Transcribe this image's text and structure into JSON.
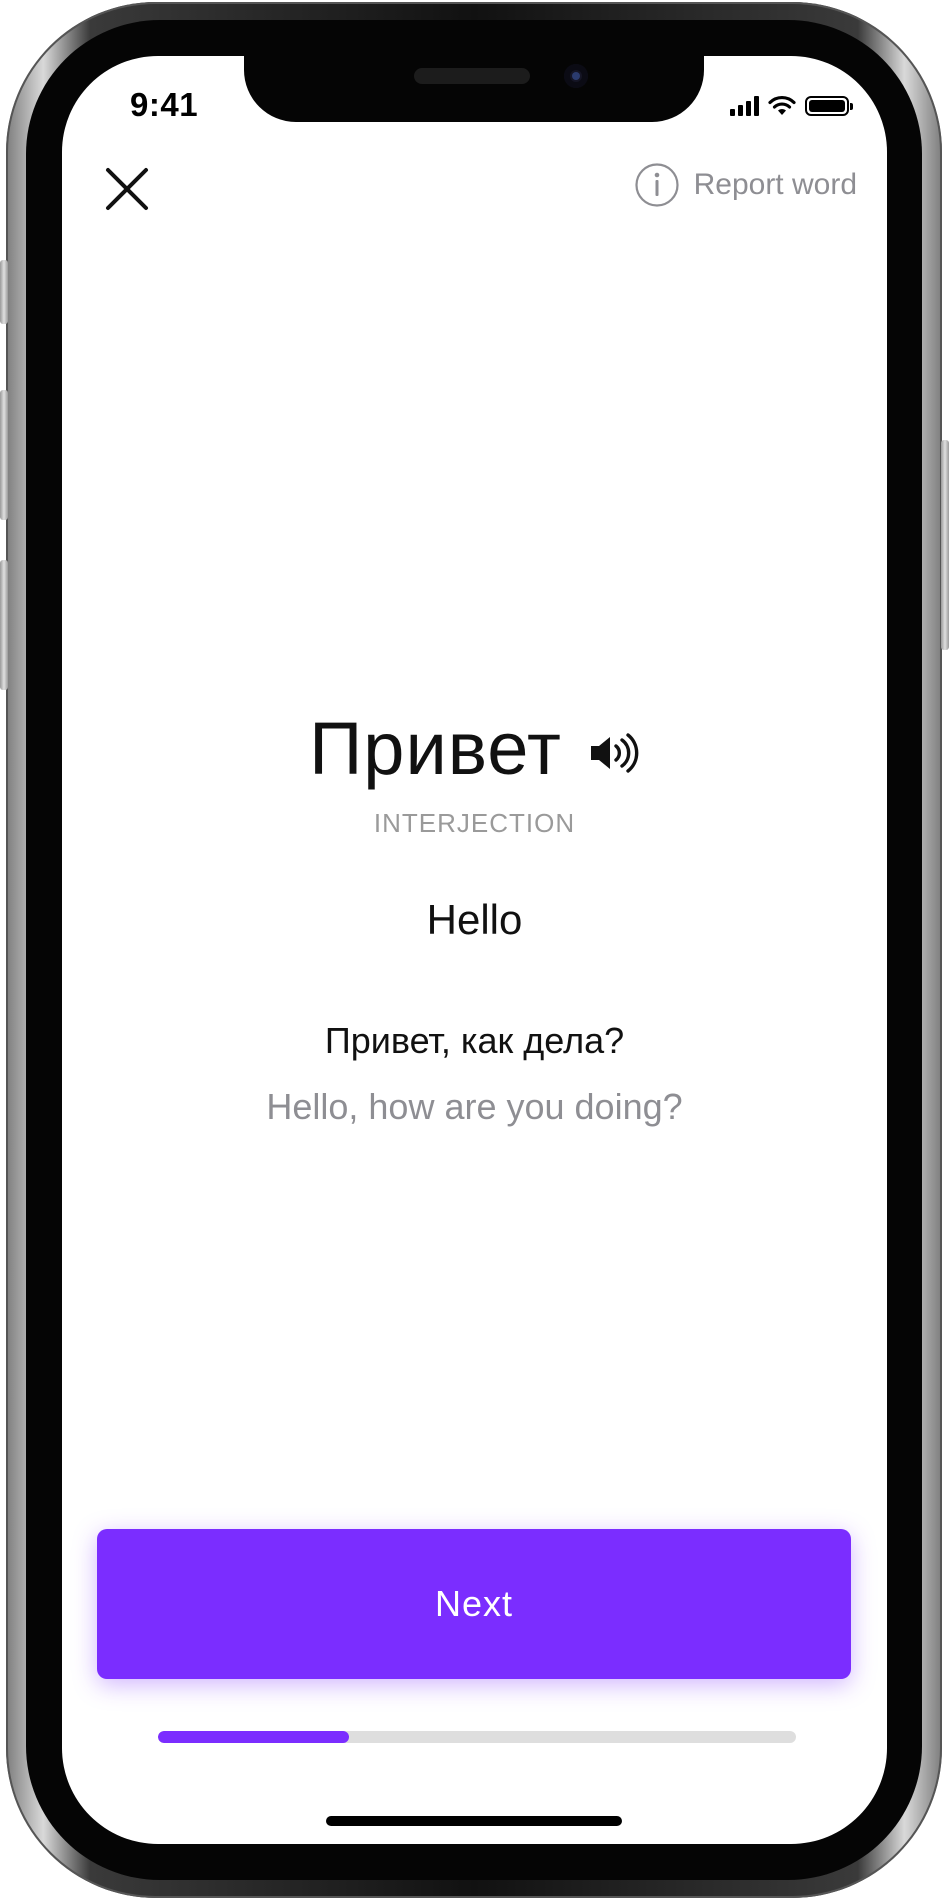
{
  "status_bar": {
    "time": "9:41",
    "icons": [
      "signal-icon",
      "wifi-icon",
      "battery-icon"
    ]
  },
  "header": {
    "close_icon": "close-icon",
    "report_icon": "info-icon",
    "report_label": "Report word"
  },
  "card": {
    "word": "Привет",
    "audio_icon": "speaker-icon",
    "part_of_speech": "INTERJECTION",
    "translation": "Hello",
    "example": "Привет, как дела?",
    "example_translation": "Hello, how are you doing?"
  },
  "footer": {
    "next_label": "Next",
    "progress_fraction": 0.3
  },
  "colors": {
    "accent": "#7b2dff",
    "track": "#dedede",
    "muted_text": "#8e8e93",
    "primary_text": "#111111"
  }
}
